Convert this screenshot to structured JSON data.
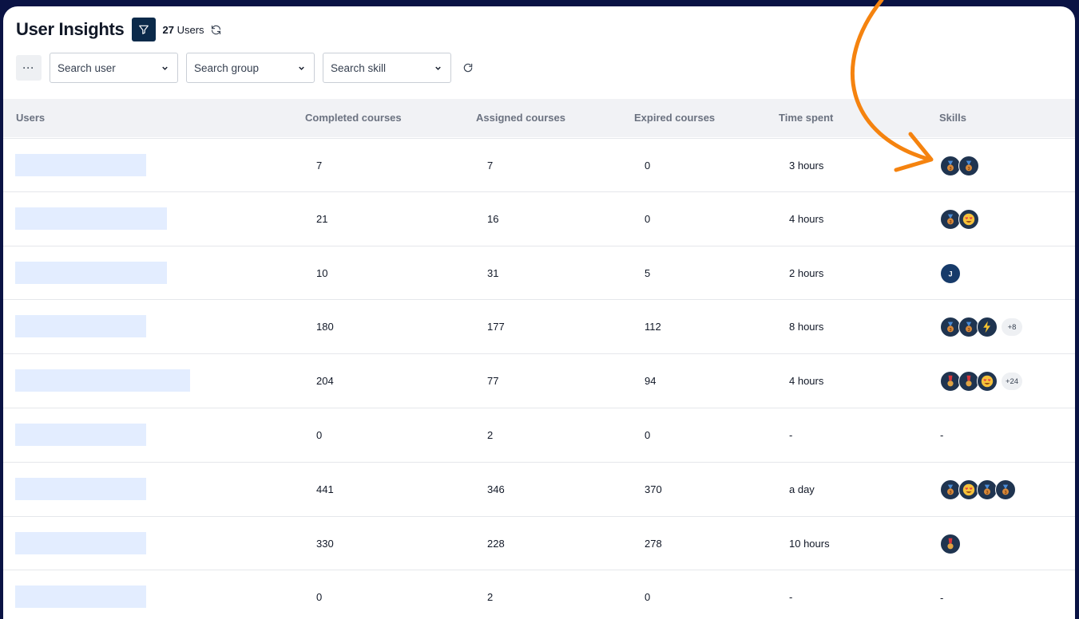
{
  "header": {
    "title": "User Insights",
    "user_count": "27",
    "user_count_suffix": "Users"
  },
  "toolbar": {
    "more_label": "···",
    "search_user_placeholder": "Search user",
    "search_group_placeholder": "Search group",
    "search_skill_placeholder": "Search skill"
  },
  "table": {
    "columns": [
      "Users",
      "Completed courses",
      "Assigned courses",
      "Expired courses",
      "Time spent",
      "Skills"
    ],
    "rows": [
      {
        "completed": "7",
        "assigned": "7",
        "expired": "0",
        "time": "3 hours",
        "skills": [
          "bronze-medal",
          "bronze-medal"
        ],
        "more": ""
      },
      {
        "completed": "21",
        "assigned": "16",
        "expired": "0",
        "time": "4 hours",
        "skills": [
          "bronze-medal",
          "heart-eyes"
        ],
        "more": ""
      },
      {
        "completed": "10",
        "assigned": "31",
        "expired": "5",
        "time": "2 hours",
        "skills": [
          "letter-j"
        ],
        "more": ""
      },
      {
        "completed": "180",
        "assigned": "177",
        "expired": "112",
        "time": "8 hours",
        "skills": [
          "bronze-medal",
          "bronze-medal",
          "lightning"
        ],
        "more": "+8"
      },
      {
        "completed": "204",
        "assigned": "77",
        "expired": "94",
        "time": "4 hours",
        "skills": [
          "red-medal",
          "red-medal",
          "heart-eyes"
        ],
        "more": "+24"
      },
      {
        "completed": "0",
        "assigned": "2",
        "expired": "0",
        "time": "-",
        "skills": [],
        "skills_text": "-",
        "more": ""
      },
      {
        "completed": "441",
        "assigned": "346",
        "expired": "370",
        "time": "a day",
        "skills": [
          "bronze-medal",
          "heart-eyes",
          "bronze-medal",
          "bronze-medal"
        ],
        "more": ""
      },
      {
        "completed": "330",
        "assigned": "228",
        "expired": "278",
        "time": "10 hours",
        "skills": [
          "red-medal"
        ],
        "more": ""
      },
      {
        "completed": "0",
        "assigned": "2",
        "expired": "0",
        "time": "-",
        "skills": [],
        "skills_text": "-",
        "more": ""
      }
    ]
  },
  "colors": {
    "background": "#0a1344",
    "accent_arrow": "#f5830f",
    "filter_button": "#0b2a4a",
    "name_placeholder": "#e3edff",
    "header_row": "#f1f2f5"
  }
}
